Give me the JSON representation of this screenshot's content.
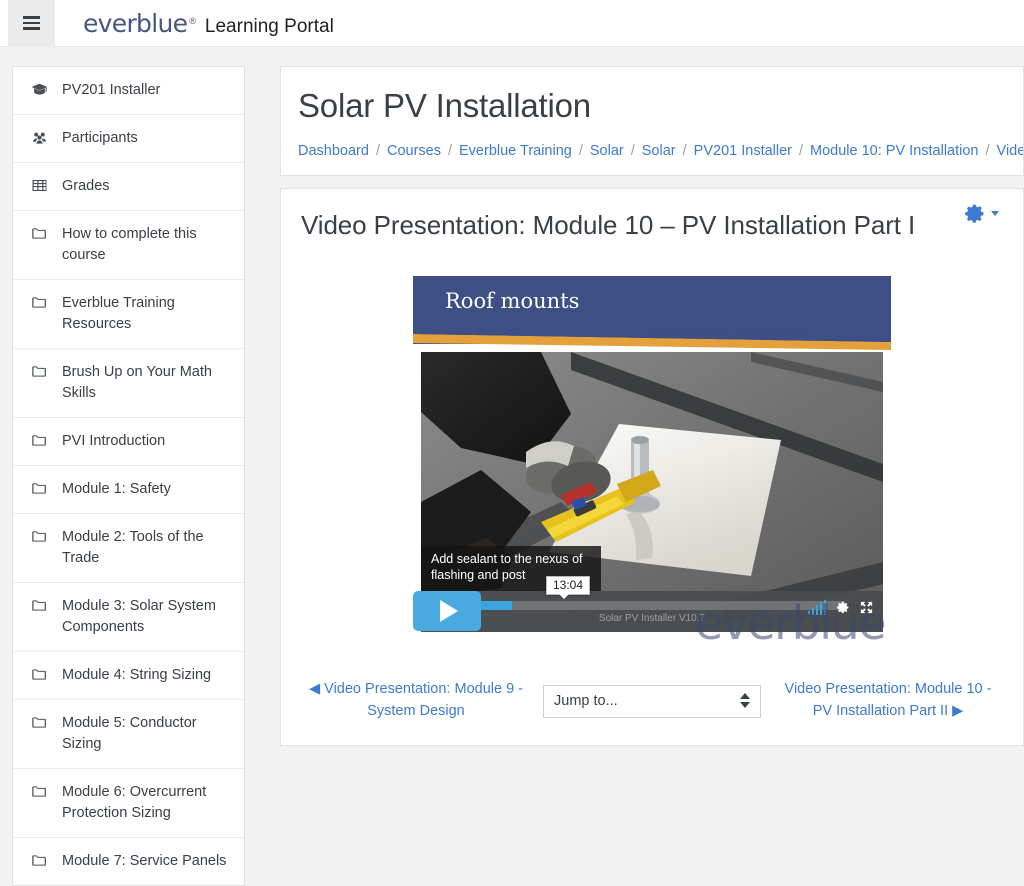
{
  "navbar": {
    "menu_icon": "hamburger-icon",
    "brand_name": "everblue",
    "brand_registered": "®",
    "brand_suffix": "Learning Portal"
  },
  "sidebar": {
    "items": [
      {
        "label": "PV201 Installer",
        "icon": "graduation-cap-icon"
      },
      {
        "label": "Participants",
        "icon": "users-icon"
      },
      {
        "label": "Grades",
        "icon": "grid-table-icon"
      },
      {
        "label": "How to complete this course",
        "icon": "folder-icon"
      },
      {
        "label": "Everblue Training Resources",
        "icon": "folder-icon"
      },
      {
        "label": "Brush Up on Your Math Skills",
        "icon": "folder-icon"
      },
      {
        "label": "PVI Introduction",
        "icon": "folder-icon"
      },
      {
        "label": "Module 1: Safety",
        "icon": "folder-icon"
      },
      {
        "label": "Module 2: Tools of the Trade",
        "icon": "folder-icon"
      },
      {
        "label": "Module 3: Solar System Components",
        "icon": "folder-icon"
      },
      {
        "label": "Module 4: String Sizing",
        "icon": "folder-icon"
      },
      {
        "label": "Module 5: Conductor Sizing",
        "icon": "folder-icon"
      },
      {
        "label": "Module 6: Overcurrent Protection Sizing",
        "icon": "folder-icon"
      },
      {
        "label": "Module 7: Service Panels",
        "icon": "folder-icon"
      }
    ]
  },
  "page": {
    "title": "Solar PV Installation",
    "breadcrumb": [
      "Dashboard",
      "Courses",
      "Everblue Training",
      "Solar",
      "Solar",
      "PV201 Installer",
      "Module 10: PV Installation",
      "Vide"
    ],
    "breadcrumb_separator": "/"
  },
  "activity": {
    "title": "Video Presentation: Module 10 – PV Installation Part I",
    "settings_icon": "gear-icon",
    "settings_caret_icon": "chevron-down-icon"
  },
  "video": {
    "slide_title": "Roof mounts",
    "caption": "Add sealant to the nexus of flashing and post",
    "timecode": "13:04",
    "filename": "Solar PV Installer V10.7",
    "play_icon": "play-icon",
    "volume_icon": "volume-bars-icon",
    "settings_icon": "gear-icon",
    "fullscreen_icon": "fullscreen-icon",
    "watermark": "everblue",
    "progress_percent": 15
  },
  "activity_nav": {
    "prev_label": "◀ Video Presentation: Module 9 - System Design",
    "jumpto_value": "Jump to...",
    "next_label": "Video Presentation: Module 10 - PV Installation Part II ▶"
  },
  "colors": {
    "link_blue": "#3d7ad0",
    "brand_navy": "#48567f",
    "slide_navy": "#3d4f84",
    "slide_orange": "#e4a03a",
    "player_blue": "#4aaae0"
  }
}
